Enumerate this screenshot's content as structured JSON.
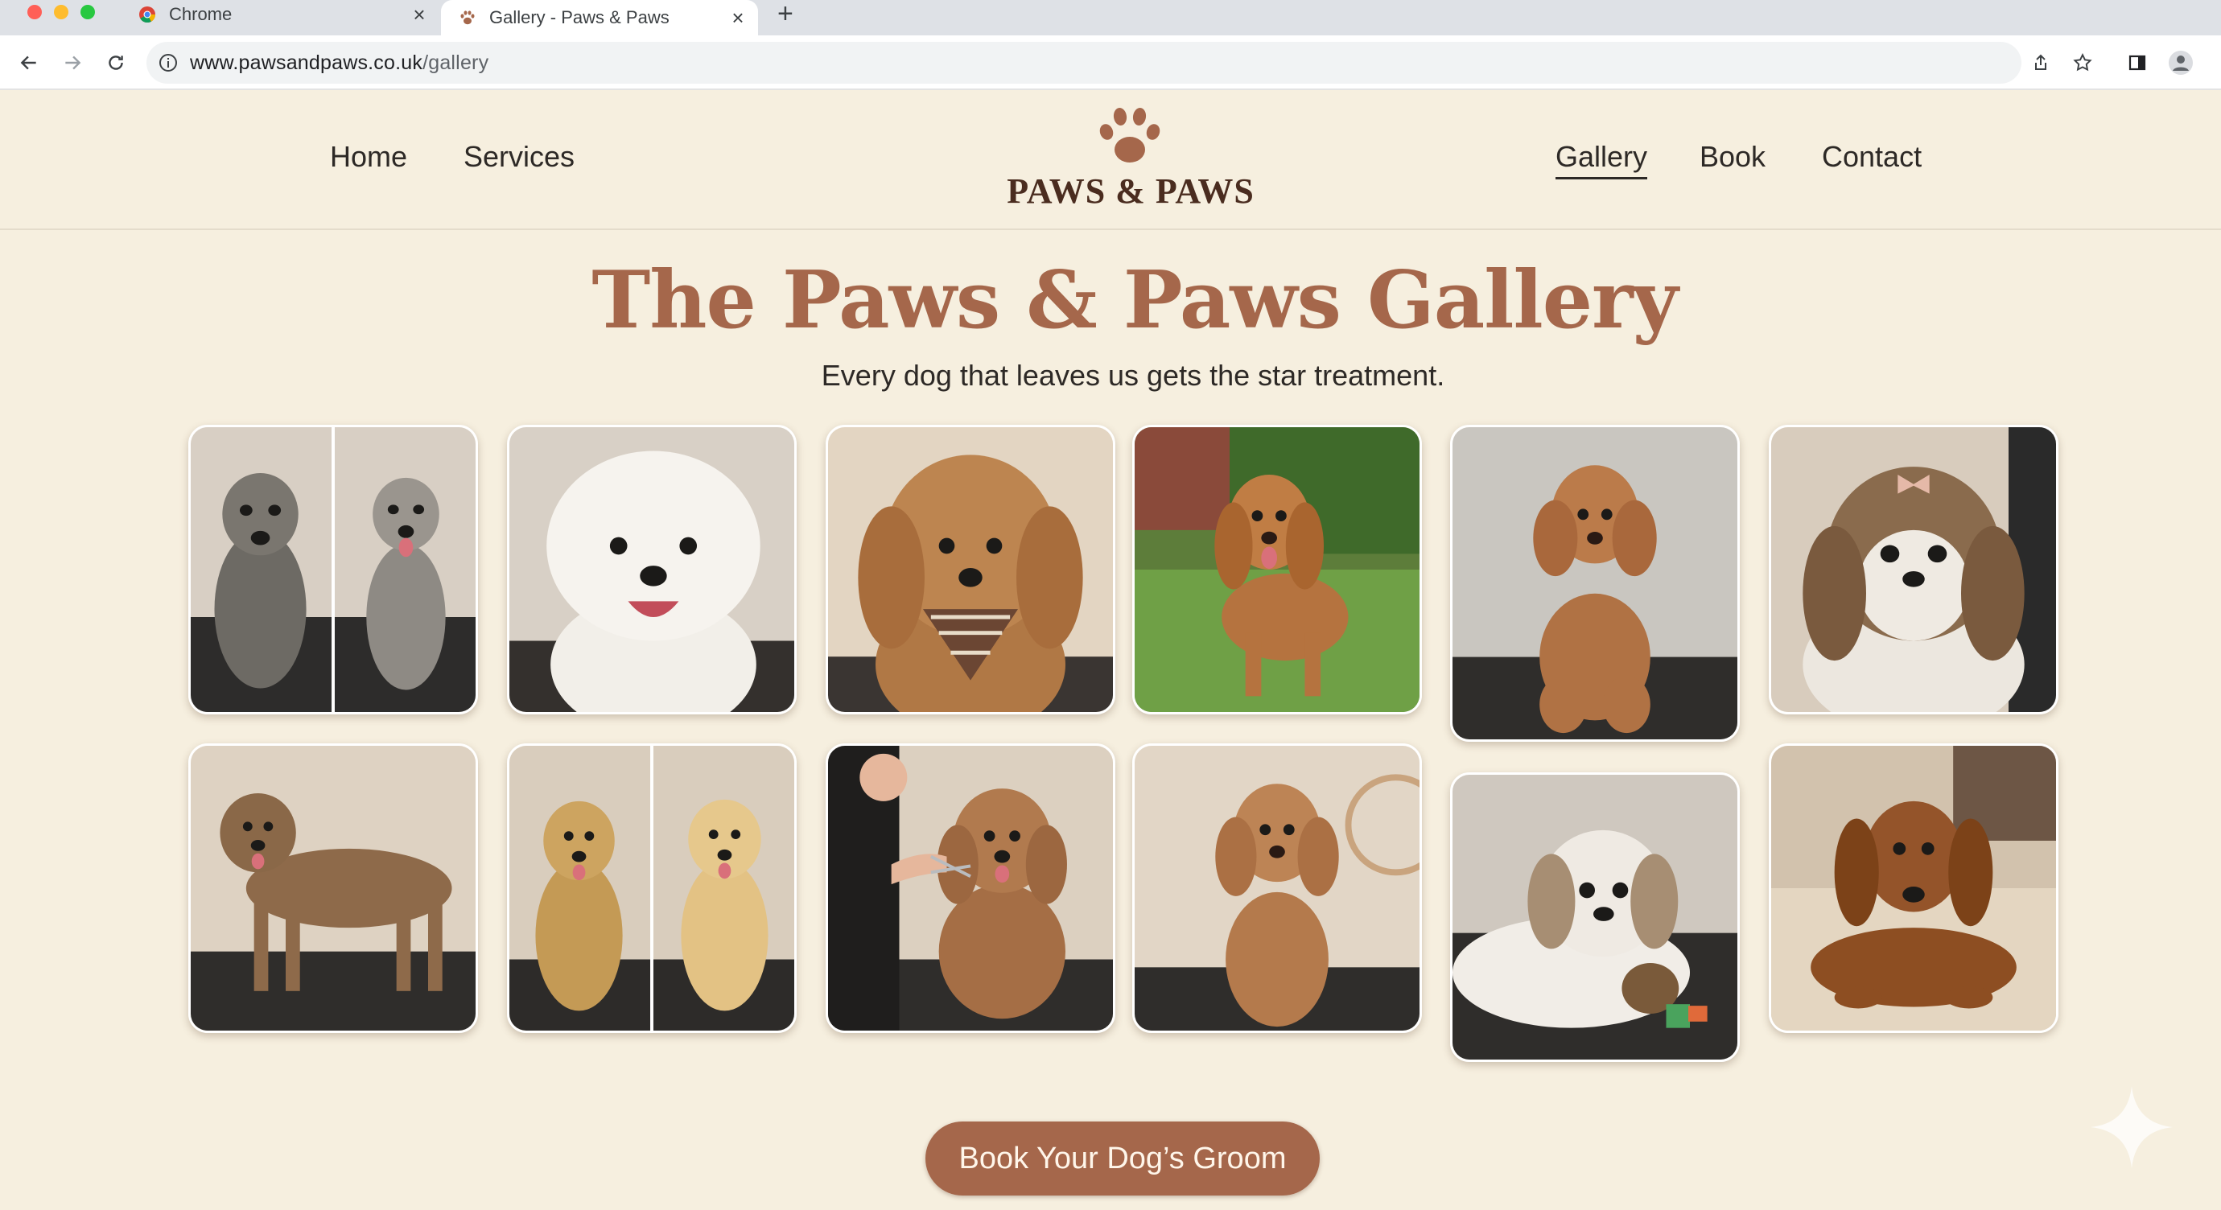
{
  "browser": {
    "tabs": [
      {
        "title": "Chrome",
        "favicon": "chrome-icon",
        "active": false
      },
      {
        "title": "Gallery - Paws & Paws",
        "favicon": "paw-icon",
        "active": true
      }
    ],
    "url_host": "www.pawsandpaws.co.uk",
    "url_path": "/gallery"
  },
  "nav": {
    "left": [
      {
        "label": "Home"
      },
      {
        "label": "Services"
      }
    ],
    "right": [
      {
        "label": "Gallery",
        "active": true
      },
      {
        "label": "Book"
      },
      {
        "label": "Contact"
      }
    ]
  },
  "brand": {
    "name": "PAWS & PAWS",
    "color": "#a5674b"
  },
  "hero": {
    "title": "The Paws & Paws Gallery",
    "subtitle": "Every dog that leaves us gets the star treatment."
  },
  "gallery": {
    "photos": [
      {
        "subject": "schnauzer before and after groom",
        "split": true
      },
      {
        "subject": "white bichon frise"
      },
      {
        "subject": "cockapoo with plaid bandana"
      },
      {
        "subject": "cocker spaniel on lawn"
      },
      {
        "subject": "brown standard poodle on table"
      },
      {
        "subject": "shih tzu with bow"
      },
      {
        "subject": "border terrier standing"
      },
      {
        "subject": "golden retriever before and after bath",
        "split": true
      },
      {
        "subject": "groomer scissoring a doodle"
      },
      {
        "subject": "apricot poodle sitting"
      },
      {
        "subject": "shih tzu lying with toy"
      },
      {
        "subject": "dachshund on blanket"
      }
    ]
  },
  "cta": {
    "label": "Book Your Dog’s Groom"
  }
}
